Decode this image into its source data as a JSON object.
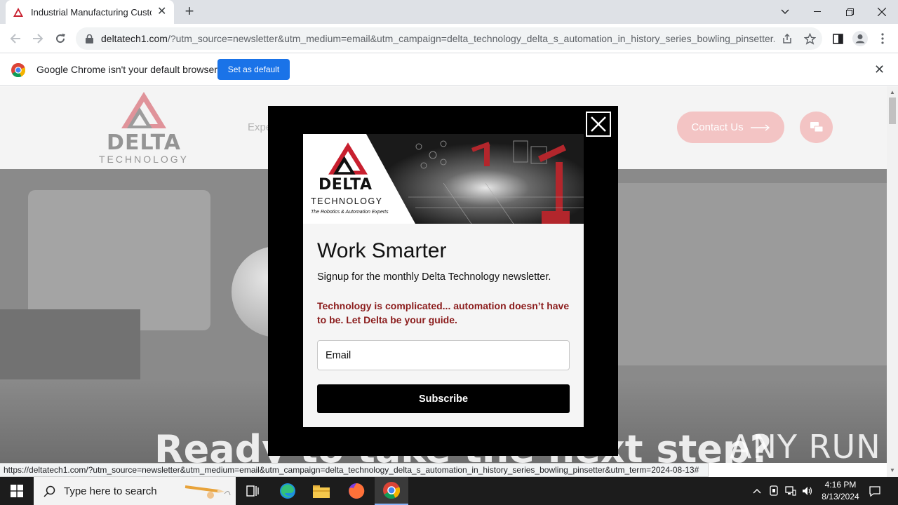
{
  "browser": {
    "tab_title": "Industrial Manufacturing Custom",
    "tab_close": "✕",
    "new_tab": "+",
    "url_host": "deltatech1.com",
    "url_path": "/?utm_source=newsletter&utm_medium=email&utm_campaign=delta_technology_delta_s_automation_in_history_series_bowling_pinsetter...",
    "status_url": "https://deltatech1.com/?utm_source=newsletter&utm_medium=email&utm_campaign=delta_technology_delta_s_automation_in_history_series_bowling_pinsetter&utm_term=2024-08-13#"
  },
  "infobar": {
    "message": "Google Chrome isn't your default browser",
    "button": "Set as default",
    "close": "✕"
  },
  "site": {
    "logo_word": "DELTA",
    "logo_sub": "TECHNOLOGY",
    "nav_partial": "Expe",
    "contact_label": "Contact Us",
    "hero_headline": "Ready to take the next step?"
  },
  "modal": {
    "close": "✕",
    "banner_name": "DELTA",
    "banner_tech": "TECHNOLOGY",
    "banner_tagline": "The Robotics & Automation Experts",
    "title": "Work Smarter",
    "subtitle": "Signup for the monthly Delta Technology newsletter.",
    "tagline": "Technology is complicated... automation doesn’t have to be. Let Delta be your guide.",
    "email_placeholder": "Email",
    "subscribe": "Subscribe"
  },
  "watermark": "ANY RUN",
  "taskbar": {
    "search_placeholder": "Type here to search",
    "time": "4:16 PM",
    "date": "8/13/2024"
  },
  "colors": {
    "brand_red": "#c8202f",
    "tagline_red": "#8b1c1c",
    "chrome_blue": "#1a73e8"
  }
}
